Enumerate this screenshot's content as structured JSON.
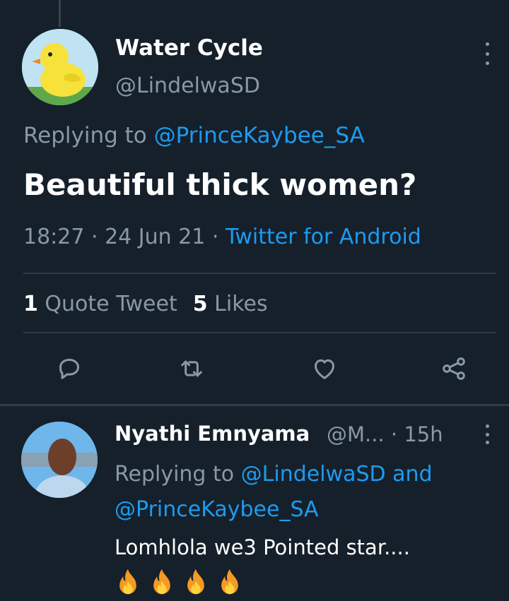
{
  "tweet": {
    "display_name": "Water Cycle",
    "handle": "@LindelwaSD",
    "replying_prefix": "Replying to ",
    "replying_to": "@PrinceKaybee_SA",
    "text": "Beautiful thick women?",
    "time": "18:27",
    "date": "24 Jun 21",
    "separator": " · ",
    "source": "Twitter for Android",
    "quote_count": "1",
    "quote_label": "Quote Tweet",
    "like_count": "5",
    "like_label": "Likes"
  },
  "reply": {
    "display_name": "Nyathi Emnyama",
    "handle": "@M...",
    "time": "· 15h",
    "replying_prefix": "Replying to ",
    "mention_1": "@LindelwaSD",
    "and_word": " and",
    "mention_2": "@PrinceKaybee_SA",
    "text": "Lomhlola we3 Pointed star....",
    "emojis": [
      "fire-emoji",
      "fire-emoji",
      "fire-emoji",
      "fire-emoji"
    ]
  },
  "icons": {
    "reply": "reply-icon",
    "retweet": "retweet-icon",
    "like": "heart-icon",
    "share": "share-icon",
    "more": "more-vertical-icon"
  },
  "colors": {
    "background": "#15202b",
    "text_primary": "#ffffff",
    "text_secondary": "#8899a6",
    "accent": "#1d9bf0",
    "divider": "#2f3b45"
  }
}
